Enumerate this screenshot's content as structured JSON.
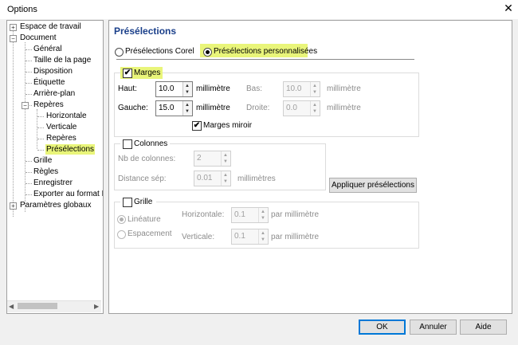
{
  "window": {
    "title": "Options"
  },
  "tree": {
    "items": [
      {
        "label": "Espace de travail"
      },
      {
        "label": "Document"
      },
      {
        "label": "Général"
      },
      {
        "label": "Taille de la page"
      },
      {
        "label": "Disposition"
      },
      {
        "label": "Étiquette"
      },
      {
        "label": "Arrière-plan"
      },
      {
        "label": "Repères"
      },
      {
        "label": "Horizontale"
      },
      {
        "label": "Verticale"
      },
      {
        "label": "Repères"
      },
      {
        "label": "Présélections"
      },
      {
        "label": "Grille"
      },
      {
        "label": "Règles"
      },
      {
        "label": "Enregistrer"
      },
      {
        "label": "Exporter au format HTML"
      },
      {
        "label": "Paramètres globaux"
      }
    ],
    "selected": "Présélections"
  },
  "panel": {
    "heading": "Présélections",
    "preset_type": {
      "corel_label": "Présélections Corel",
      "custom_label": "Présélections personnalisées",
      "selected": "custom"
    },
    "margins": {
      "label": "Marges",
      "checked": true,
      "top_label": "Haut:",
      "top_value": "10.0",
      "top_unit": "millimètre",
      "bottom_label": "Bas:",
      "bottom_value": "10.0",
      "bottom_unit": "millimètre",
      "left_label": "Gauche:",
      "left_value": "15.0",
      "left_unit": "millimètre",
      "right_label": "Droite:",
      "right_value": "0.0",
      "right_unit": "millimètre",
      "mirror_label": "Marges miroir",
      "mirror_checked": true
    },
    "columns": {
      "label": "Colonnes",
      "checked": false,
      "count_label": "Nb de colonnes:",
      "count_value": "2",
      "gutter_label": "Distance sép:",
      "gutter_value": "0.01",
      "gutter_unit": "millimètres"
    },
    "apply_button": "Appliquer présélections",
    "grid": {
      "label": "Grille",
      "checked": false,
      "line_label": "Linéature",
      "spacing_label": "Espacement",
      "mode_selected": "line",
      "horizontal_label": "Horizontale:",
      "horizontal_value": "0.1",
      "horizontal_unit": "par millimètre",
      "vertical_label": "Verticale:",
      "vertical_value": "0.1",
      "vertical_unit": "par millimètre"
    }
  },
  "buttons": {
    "ok": "OK",
    "cancel": "Annuler",
    "help": "Aide"
  },
  "colors": {
    "highlight": "#e9f57a",
    "heading": "#1a3f8a",
    "default_button_border": "#0078d7"
  }
}
